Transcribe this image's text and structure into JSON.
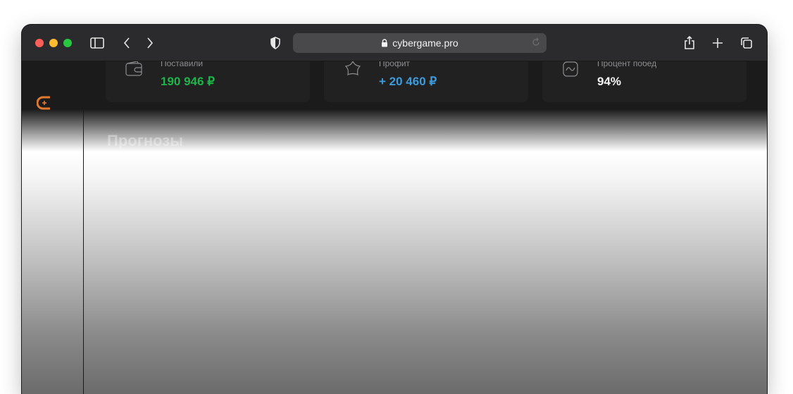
{
  "browser": {
    "url": "cybergame.pro",
    "icons": {
      "sidebar_toggle": "sidebar-icon",
      "back": "chevron-left-icon",
      "forward": "chevron-right-icon",
      "privacy": "shield-icon",
      "lock": "lock-icon",
      "reload": "reload-icon",
      "share": "share-icon",
      "new_tab": "plus-icon",
      "tabs": "tabs-overview-icon"
    }
  },
  "stats": [
    {
      "label": "Поставили",
      "value": "190 946 ₽",
      "icon": "wallet-icon",
      "color": "#1fb44a"
    },
    {
      "label": "Профит",
      "value": "+ 20 460 ₽",
      "icon": "star-icon",
      "color": "#3b9bdc"
    },
    {
      "label": "Процент побед",
      "value": "94%",
      "icon": "chart-icon",
      "color": "#f4f4f4"
    }
  ],
  "section_title": "Прогнозы",
  "colors": {
    "brand": "#e07a2f",
    "card_bg": "#212122",
    "toolbar_bg": "#2b2b2d"
  }
}
